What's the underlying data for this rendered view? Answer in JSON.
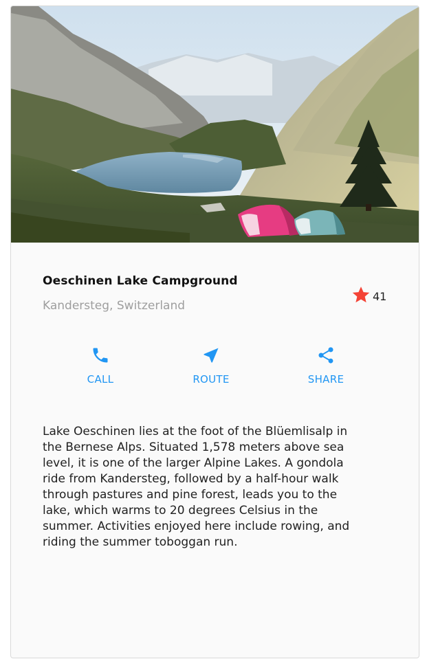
{
  "hero": {
    "image_alt": "Oeschinen Lake with tents"
  },
  "title_section": {
    "title": "Oeschinen Lake Campground",
    "subtitle": "Kandersteg, Switzerland",
    "favorite_count": "41",
    "favorite_icon": "star-icon",
    "favorite_color": "#f44336"
  },
  "buttons": {
    "accent_color": "#2196f3",
    "items": [
      {
        "label": "CALL",
        "icon": "phone-icon"
      },
      {
        "label": "ROUTE",
        "icon": "near-me-icon"
      },
      {
        "label": "SHARE",
        "icon": "share-icon"
      }
    ]
  },
  "description": "Lake Oeschinen lies at the foot of the Blüemlisalp in\nthe Bernese Alps. Situated 1,578 meters above sea\nlevel, it is one of the larger Alpine Lakes. A gondola\nride from Kandersteg, followed by a half-hour walk\nthrough pastures and pine forest, leads you to the\nlake, which warms to 20 degrees Celsius in the\nsummer. Activities enjoyed here include rowing, and\nriding the summer toboggan run."
}
